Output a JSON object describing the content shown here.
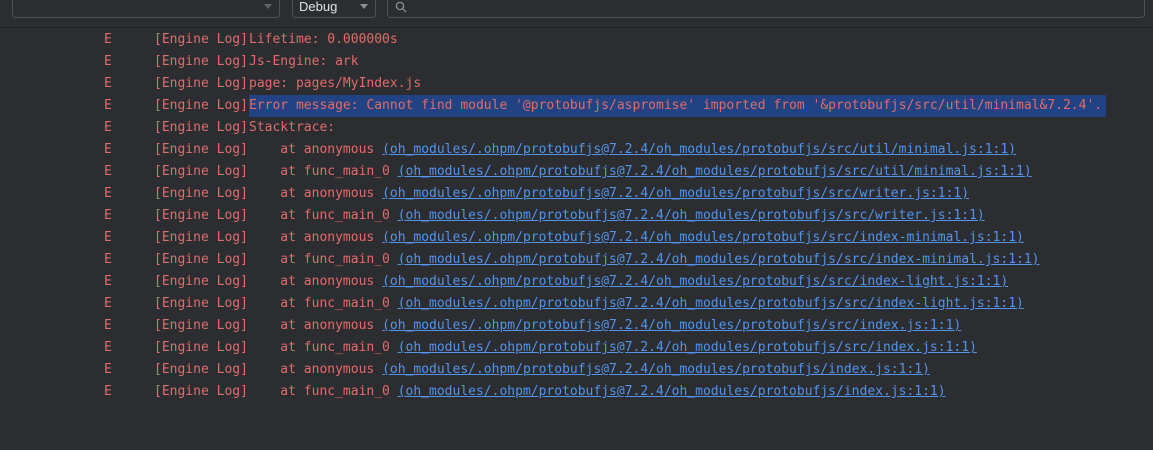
{
  "toolbar": {
    "filter_value": "",
    "log_level": "Debug",
    "search_value": ""
  },
  "colors": {
    "error_text": "#e06c6c",
    "link": "#5394ec",
    "selection": "#214283",
    "background": "#2b2d30"
  },
  "log": {
    "rows": [
      {
        "level": "E",
        "tag": "[Engine Log]",
        "text": "Lifetime: 0.000000s",
        "link": ""
      },
      {
        "level": "E",
        "tag": "[Engine Log]",
        "text": "Js-Engine: ark",
        "link": ""
      },
      {
        "level": "E",
        "tag": "[Engine Log]",
        "text": "page: pages/MyIndex.js",
        "link": ""
      },
      {
        "level": "E",
        "tag": "[Engine Log]",
        "text": "Error message: Cannot find module '@protobufjs/aspromise' imported from '&protobufjs/src/util/minimal&7.2.4'.",
        "link": ""
      },
      {
        "level": "E",
        "tag": "[Engine Log]",
        "text": "Stacktrace:",
        "link": ""
      },
      {
        "level": "E",
        "tag": "[Engine Log]",
        "text": "    at anonymous ",
        "link": "(oh_modules/.ohpm/protobufjs@7.2.4/oh_modules/protobufjs/src/util/minimal.js:1:1)"
      },
      {
        "level": "E",
        "tag": "[Engine Log]",
        "text": "    at func_main_0 ",
        "link": "(oh_modules/.ohpm/protobufjs@7.2.4/oh_modules/protobufjs/src/util/minimal.js:1:1)"
      },
      {
        "level": "E",
        "tag": "[Engine Log]",
        "text": "    at anonymous ",
        "link": "(oh_modules/.ohpm/protobufjs@7.2.4/oh_modules/protobufjs/src/writer.js:1:1)"
      },
      {
        "level": "E",
        "tag": "[Engine Log]",
        "text": "    at func_main_0 ",
        "link": "(oh_modules/.ohpm/protobufjs@7.2.4/oh_modules/protobufjs/src/writer.js:1:1)"
      },
      {
        "level": "E",
        "tag": "[Engine Log]",
        "text": "    at anonymous ",
        "link": "(oh_modules/.ohpm/protobufjs@7.2.4/oh_modules/protobufjs/src/index-minimal.js:1:1)"
      },
      {
        "level": "E",
        "tag": "[Engine Log]",
        "text": "    at func_main_0 ",
        "link": "(oh_modules/.ohpm/protobufjs@7.2.4/oh_modules/protobufjs/src/index-minimal.js:1:1)"
      },
      {
        "level": "E",
        "tag": "[Engine Log]",
        "text": "    at anonymous ",
        "link": "(oh_modules/.ohpm/protobufjs@7.2.4/oh_modules/protobufjs/src/index-light.js:1:1)"
      },
      {
        "level": "E",
        "tag": "[Engine Log]",
        "text": "    at func_main_0 ",
        "link": "(oh_modules/.ohpm/protobufjs@7.2.4/oh_modules/protobufjs/src/index-light.js:1:1)"
      },
      {
        "level": "E",
        "tag": "[Engine Log]",
        "text": "    at anonymous ",
        "link": "(oh_modules/.ohpm/protobufjs@7.2.4/oh_modules/protobufjs/src/index.js:1:1)"
      },
      {
        "level": "E",
        "tag": "[Engine Log]",
        "text": "    at func_main_0 ",
        "link": "(oh_modules/.ohpm/protobufjs@7.2.4/oh_modules/protobufjs/src/index.js:1:1)"
      },
      {
        "level": "E",
        "tag": "[Engine Log]",
        "text": "    at anonymous ",
        "link": "(oh_modules/.ohpm/protobufjs@7.2.4/oh_modules/protobufjs/index.js:1:1)"
      },
      {
        "level": "E",
        "tag": "[Engine Log]",
        "text": "    at func_main_0 ",
        "link": "(oh_modules/.ohpm/protobufjs@7.2.4/oh_modules/protobufjs/index.js:1:1)"
      }
    ]
  }
}
